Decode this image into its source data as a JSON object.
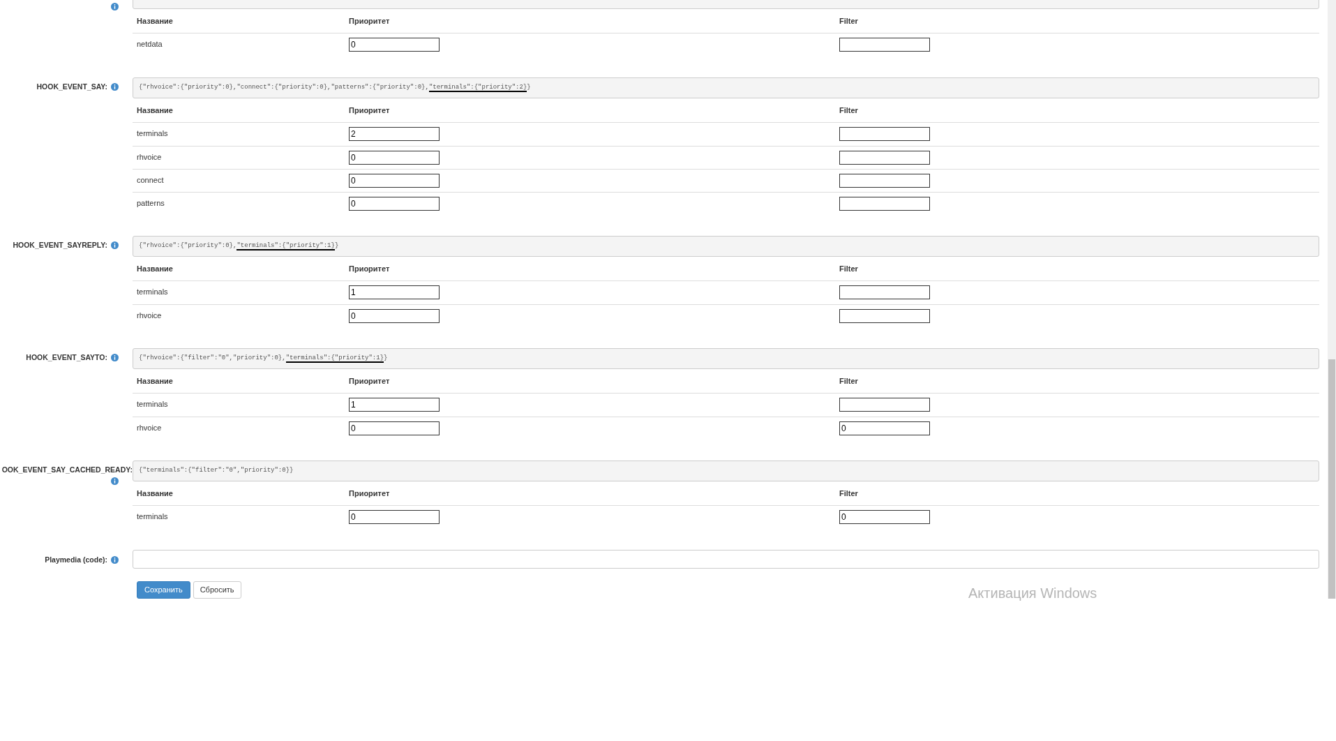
{
  "top_section": {
    "columns": [
      "Название",
      "Приоритет",
      "Filter"
    ],
    "rows": [
      {
        "name": "netdata",
        "priority": "0",
        "filter": ""
      }
    ]
  },
  "sections": [
    {
      "label": "HOOK_EVENT_SAY:",
      "code": "{\"rhvoice\":{\"priority\":0},\"connect\":{\"priority\":0},\"patterns\":{\"priority\":0},",
      "underlined": "\"terminals\":{\"priority\":2}",
      "code_end": "}",
      "columns": [
        "Название",
        "Приоритет",
        "Filter"
      ],
      "rows": [
        {
          "name": "terminals",
          "priority": "2",
          "filter": ""
        },
        {
          "name": "rhvoice",
          "priority": "0",
          "filter": ""
        },
        {
          "name": "connect",
          "priority": "0",
          "filter": ""
        },
        {
          "name": "patterns",
          "priority": "0",
          "filter": ""
        }
      ]
    },
    {
      "label": "HOOK_EVENT_SAYREPLY:",
      "code": "{\"rhvoice\":{\"priority\":0},",
      "underlined": "\"terminals\":{\"priority\":1}",
      "code_end": "}",
      "columns": [
        "Название",
        "Приоритет",
        "Filter"
      ],
      "rows": [
        {
          "name": "terminals",
          "priority": "1",
          "filter": ""
        },
        {
          "name": "rhvoice",
          "priority": "0",
          "filter": ""
        }
      ]
    },
    {
      "label": "HOOK_EVENT_SAYTO:",
      "code": "{\"rhvoice\":{\"filter\":\"0\",\"priority\":0},",
      "underlined": "\"terminals\":{\"priority\":1}",
      "code_end": "}",
      "columns": [
        "Название",
        "Приоритет",
        "Filter"
      ],
      "rows": [
        {
          "name": "terminals",
          "priority": "1",
          "filter": ""
        },
        {
          "name": "rhvoice",
          "priority": "0",
          "filter": "0"
        }
      ]
    },
    {
      "label": "OOK_EVENT_SAY_CACHED_READY:",
      "code": "{\"terminals\":{\"filter\":\"0\",\"priority\":0}}",
      "columns": [
        "Название",
        "Приоритет",
        "Filter"
      ],
      "rows": [
        {
          "name": "terminals",
          "priority": "0",
          "filter": "0"
        }
      ]
    }
  ],
  "playmedia": {
    "label": "Playmedia (code):"
  },
  "buttons": {
    "save": "Сохранить",
    "reset": "Сбросить"
  },
  "os_notice": "Активация Windows"
}
